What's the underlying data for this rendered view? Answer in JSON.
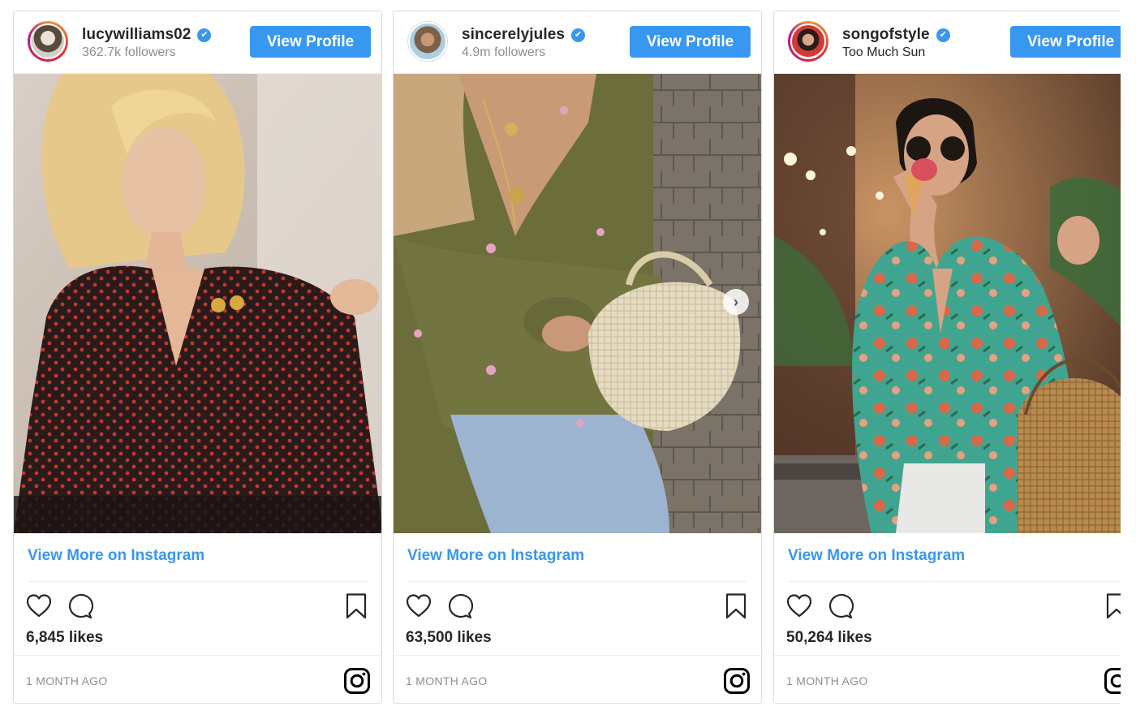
{
  "cards": [
    {
      "username": "lucywilliams02",
      "verified_mark": "✔",
      "subtitle": "362.7k followers",
      "view_profile": "View Profile",
      "view_more": "View More on Instagram",
      "likes": "6,845 likes",
      "time": "1 MONTH AGO"
    },
    {
      "username": "sincerelyjules",
      "verified_mark": "✔",
      "subtitle": "4.9m followers",
      "view_profile": "View Profile",
      "view_more": "View More on Instagram",
      "likes": "63,500 likes",
      "time": "1 MONTH AGO",
      "carousel_next": "›"
    },
    {
      "username": "songofstyle",
      "verified_mark": "✔",
      "subtitle": "Too Much Sun",
      "view_profile": "View Profile",
      "view_more": "View More on Instagram",
      "likes": "50,264 likes",
      "time": "1 MONTH AGO"
    }
  ],
  "icons": {
    "like": "heart-icon",
    "comment": "speech-bubble-icon",
    "save": "bookmark-icon",
    "brand": "instagram-icon",
    "verified": "verified-badge-icon"
  },
  "colors": {
    "link_blue": "#3897f0",
    "text": "#262626",
    "muted": "#8e8e8e",
    "border": "#dbdbdb"
  }
}
